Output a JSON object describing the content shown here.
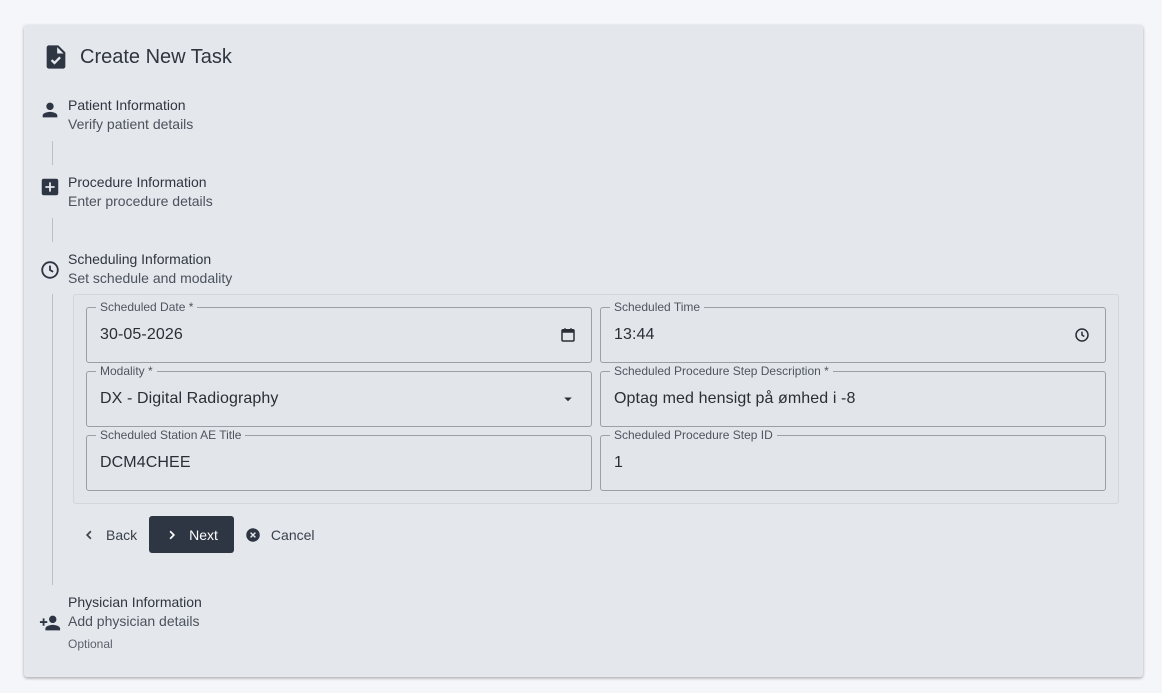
{
  "card": {
    "title": "Create New Task"
  },
  "steps": [
    {
      "title": "Patient Information",
      "subtitle": "Verify patient details",
      "icon": "person-icon"
    },
    {
      "title": "Procedure Information",
      "subtitle": "Enter procedure details",
      "icon": "medical-plus-icon"
    },
    {
      "title": "Scheduling Information",
      "subtitle": "Set schedule and modality",
      "icon": "clock-icon"
    },
    {
      "title": "Physician Information",
      "subtitle": "Add physician details",
      "optional": "Optional",
      "icon": "person-add-icon"
    }
  ],
  "form": {
    "scheduled_date": {
      "label": "Scheduled Date *",
      "value": "30-05-2026"
    },
    "scheduled_time": {
      "label": "Scheduled Time",
      "value": "13:44"
    },
    "modality": {
      "label": "Modality *",
      "value": "DX - Digital Radiography"
    },
    "step_description": {
      "label": "Scheduled Procedure Step Description *",
      "value": "Optag med hensigt på ømhed i -8"
    },
    "station_ae_title": {
      "label": "Scheduled Station AE Title",
      "value": "DCM4CHEE"
    },
    "step_id": {
      "label": "Scheduled Procedure Step ID",
      "value": "1"
    }
  },
  "actions": {
    "back": "Back",
    "next": "Next",
    "cancel": "Cancel"
  },
  "colors": {
    "primary": "#2e3644",
    "card_bg": "#e4e7ec",
    "page_bg": "#f4f6fa"
  }
}
